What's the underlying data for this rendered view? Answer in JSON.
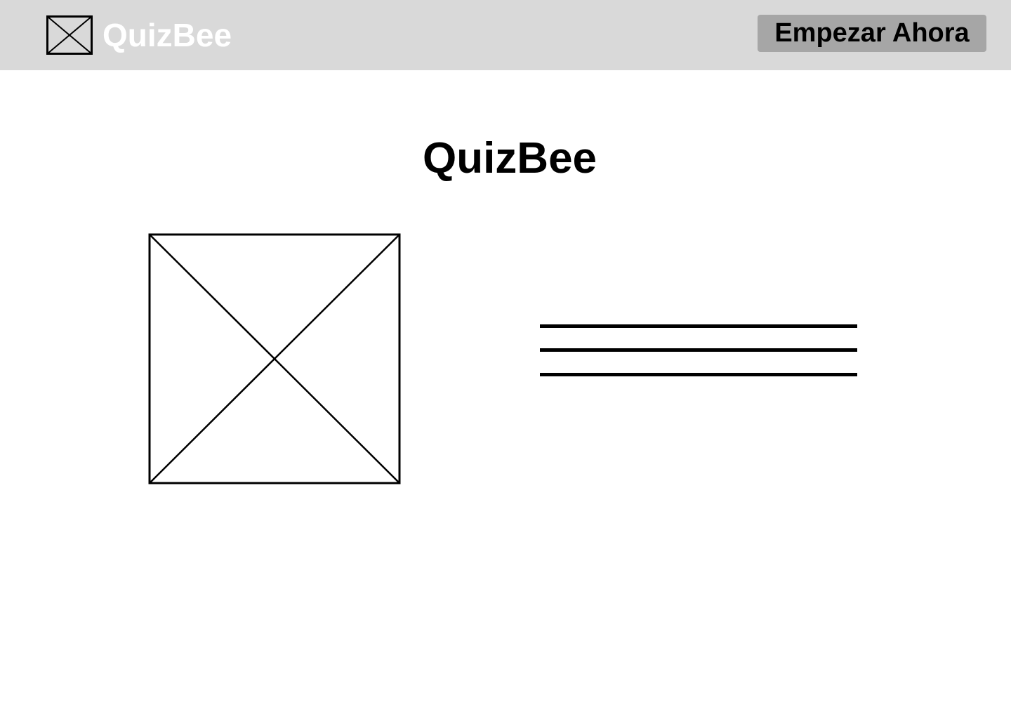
{
  "header": {
    "logo_icon": "image-placeholder-icon",
    "brand_name": "QuizBee",
    "cta_label": "Empezar Ahora"
  },
  "hero": {
    "title": "QuizBee",
    "image_icon": "image-placeholder-icon",
    "text_placeholder_lines": 3
  },
  "colors": {
    "header_background": "#d9d9d9",
    "brand_text": "#ffffff",
    "cta_background": "#a6a6a6",
    "foreground": "#000000",
    "page_background": "#ffffff"
  }
}
